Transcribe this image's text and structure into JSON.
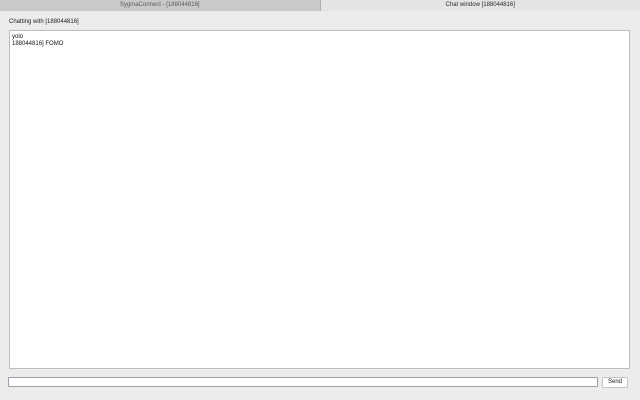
{
  "tabs": [
    {
      "label": "SygmaConnect - [188044816]",
      "active": false
    },
    {
      "label": "Chat window [188044816]",
      "active": true
    }
  ],
  "chat": {
    "heading": "Chatting with [188044816]",
    "messages": [
      "yolo",
      "188044816] FOMO"
    ]
  },
  "composer": {
    "input_value": "",
    "input_placeholder": "",
    "send_label": "Send"
  }
}
